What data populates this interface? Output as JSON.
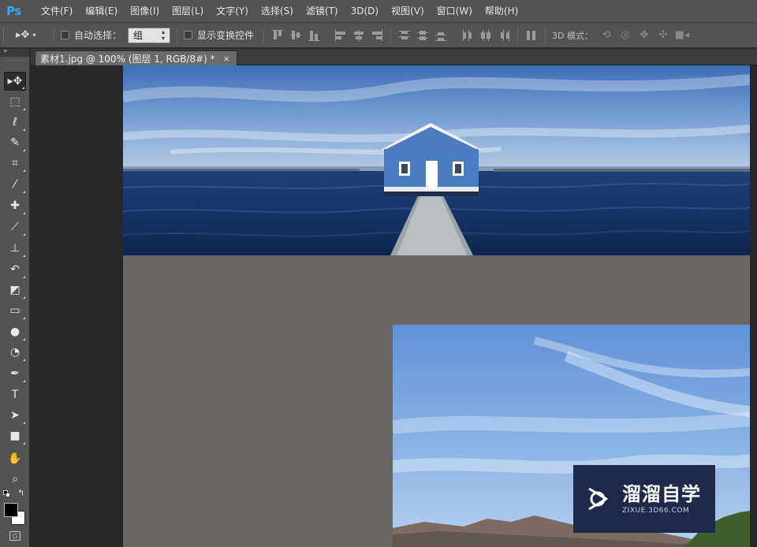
{
  "app": {
    "logo": "Ps"
  },
  "menu": [
    "文件(F)",
    "编辑(E)",
    "图像(I)",
    "图层(L)",
    "文字(Y)",
    "选择(S)",
    "滤镜(T)",
    "3D(D)",
    "视图(V)",
    "窗口(W)",
    "帮助(H)"
  ],
  "options": {
    "tool_icon": "move-tool-icon",
    "auto_select_label": "自动选择：",
    "auto_select_checked": false,
    "auto_select_value": "组",
    "show_transform_label": "显示变换控件",
    "show_transform_checked": false,
    "mode_3d_label": "3D 模式："
  },
  "document": {
    "tab_title": "素材1.jpg @ 100% (图层 1, RGB/8#) *",
    "tab_close": "×"
  },
  "tools": [
    {
      "name": "move-tool",
      "glyph": "▸✥",
      "active": true
    },
    {
      "name": "marquee-tool",
      "glyph": "⬚"
    },
    {
      "name": "lasso-tool",
      "glyph": "ℓ"
    },
    {
      "name": "quick-select-tool",
      "glyph": "✎"
    },
    {
      "name": "crop-tool",
      "glyph": "⌗"
    },
    {
      "name": "eyedropper-tool",
      "glyph": "⁄"
    },
    {
      "name": "healing-brush-tool",
      "glyph": "✚"
    },
    {
      "name": "brush-tool",
      "glyph": "⟋"
    },
    {
      "name": "clone-stamp-tool",
      "glyph": "⊥"
    },
    {
      "name": "history-brush-tool",
      "glyph": "↶"
    },
    {
      "name": "eraser-tool",
      "glyph": "◩"
    },
    {
      "name": "gradient-tool",
      "glyph": "▭"
    },
    {
      "name": "blur-tool",
      "glyph": "●"
    },
    {
      "name": "dodge-tool",
      "glyph": "◔"
    },
    {
      "name": "pen-tool",
      "glyph": "✒"
    },
    {
      "name": "type-tool",
      "glyph": "T"
    },
    {
      "name": "path-select-tool",
      "glyph": "➤"
    },
    {
      "name": "rectangle-tool",
      "glyph": "■"
    },
    {
      "name": "hand-tool",
      "glyph": "✋"
    },
    {
      "name": "zoom-tool",
      "glyph": "⌕"
    }
  ],
  "colors": {
    "foreground": "#000000",
    "background": "#ffffff",
    "canvas_bg": "#6b6661",
    "accent": "#31a8ff"
  },
  "watermark": {
    "title": "溜溜自学",
    "url": "ZIXUE.3D66.COM"
  }
}
